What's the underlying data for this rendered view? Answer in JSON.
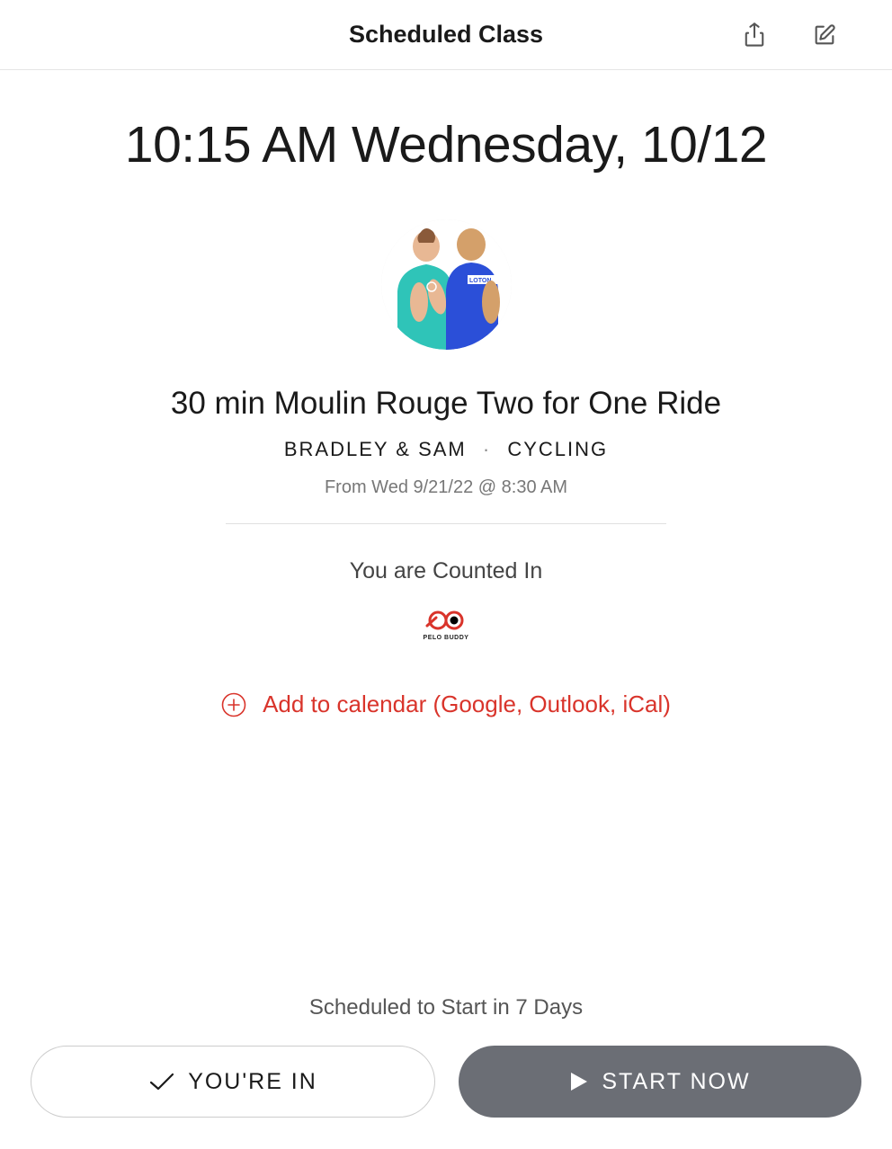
{
  "header": {
    "title": "Scheduled Class"
  },
  "class": {
    "datetime": "10:15 AM Wednesday, 10/12",
    "name": "30 min Moulin Rouge Two for One Ride",
    "instructors": "BRADLEY & SAM",
    "category": "CYCLING",
    "from_date": "From Wed 9/21/22 @ 8:30 AM",
    "counted_in": "You are Counted In",
    "badge_label": "PELO BUDDY"
  },
  "actions": {
    "add_calendar": "Add to calendar (Google, Outlook, iCal)"
  },
  "bottom": {
    "scheduled_text": "Scheduled to Start in 7 Days",
    "youre_in": "YOU'RE IN",
    "start_now": "START NOW"
  },
  "colors": {
    "accent": "#d9342b",
    "button_dark": "#6b6e75"
  }
}
